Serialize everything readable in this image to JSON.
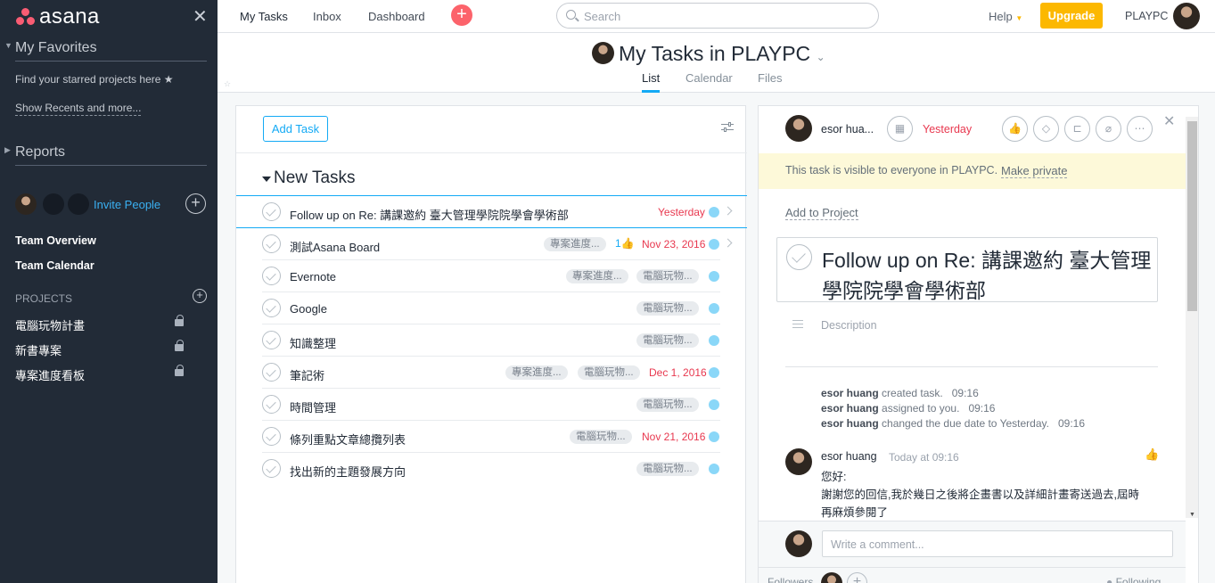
{
  "sidebar": {
    "logo_text": "asana",
    "favorites_title": "My Favorites",
    "favorites_hint": "Find your starred projects here",
    "show_recents": "Show Recents and more...",
    "reports_title": "Reports",
    "invite_people": "Invite People",
    "team_overview": "Team Overview",
    "team_calendar": "Team Calendar",
    "projects_title": "PROJECTS",
    "projects": [
      "電腦玩物計畫",
      "新書專案",
      "專案進度看板"
    ]
  },
  "topbar": {
    "nav": [
      "My Tasks",
      "Inbox",
      "Dashboard"
    ],
    "search_placeholder": "Search",
    "help": "Help",
    "upgrade": "Upgrade",
    "org": "PLAYPC"
  },
  "header": {
    "title": "My Tasks in PLAYPC",
    "tabs": [
      "List",
      "Calendar",
      "Files"
    ],
    "active_tab": "List"
  },
  "list": {
    "add_task": "Add Task",
    "section": "New Tasks",
    "tasks": [
      {
        "name": "Follow up on Re: 講課邀約 臺大管理學院院學會學術部",
        "tags": [],
        "likes": "",
        "due": "Yesterday"
      },
      {
        "name": "測試Asana Board",
        "tags": [
          "專案進度..."
        ],
        "likes": "1",
        "due": "Nov 23, 2016"
      },
      {
        "name": "Evernote",
        "tags": [
          "專案進度...",
          "電腦玩物..."
        ],
        "likes": "",
        "due": ""
      },
      {
        "name": "Google",
        "tags": [
          "電腦玩物..."
        ],
        "likes": "",
        "due": ""
      },
      {
        "name": "知識整理",
        "tags": [
          "電腦玩物..."
        ],
        "likes": "",
        "due": ""
      },
      {
        "name": "筆記術",
        "tags": [
          "專案進度...",
          "電腦玩物..."
        ],
        "likes": "",
        "due": "Dec 1, 2016"
      },
      {
        "name": "時間管理",
        "tags": [
          "電腦玩物..."
        ],
        "likes": "",
        "due": ""
      },
      {
        "name": "條列重點文章總攬列表",
        "tags": [
          "電腦玩物..."
        ],
        "likes": "",
        "due": "Nov 21, 2016"
      },
      {
        "name": "找出新的主題發展方向",
        "tags": [
          "電腦玩物..."
        ],
        "likes": "",
        "due": ""
      }
    ]
  },
  "detail": {
    "assignee": "esor hua...",
    "due": "Yesterday",
    "visibility_text": "This task is visible to everyone in PLAYPC.",
    "make_private": "Make private",
    "add_to_project": "Add to Project",
    "title": "Follow up on Re: 講課邀約 臺大管理學院院學會學術部",
    "description_placeholder": "Description",
    "stories": [
      {
        "who": "esor huang",
        "what": "created task.",
        "time": "09:16"
      },
      {
        "who": "esor huang",
        "what": "assigned to you.",
        "time": "09:16"
      },
      {
        "who": "esor huang",
        "what": "changed the due date to Yesterday.",
        "time": "09:16"
      }
    ],
    "comment": {
      "author": "esor huang",
      "time": "Today at 09:16",
      "lines": [
        "您好:",
        "謝謝您的回信,我於幾日之後將企畫書以及詳細計畫寄送過去,屆時",
        "再麻煩參閱了"
      ]
    },
    "comment_placeholder": "Write a comment...",
    "followers_label": "Followers",
    "following_label": "Following"
  },
  "colors": {
    "sidebar_bg": "#222b37",
    "accent": "#14aaf5",
    "upgrade": "#fcb800",
    "due_red": "#e8384f",
    "add_button": "#fc636b"
  }
}
